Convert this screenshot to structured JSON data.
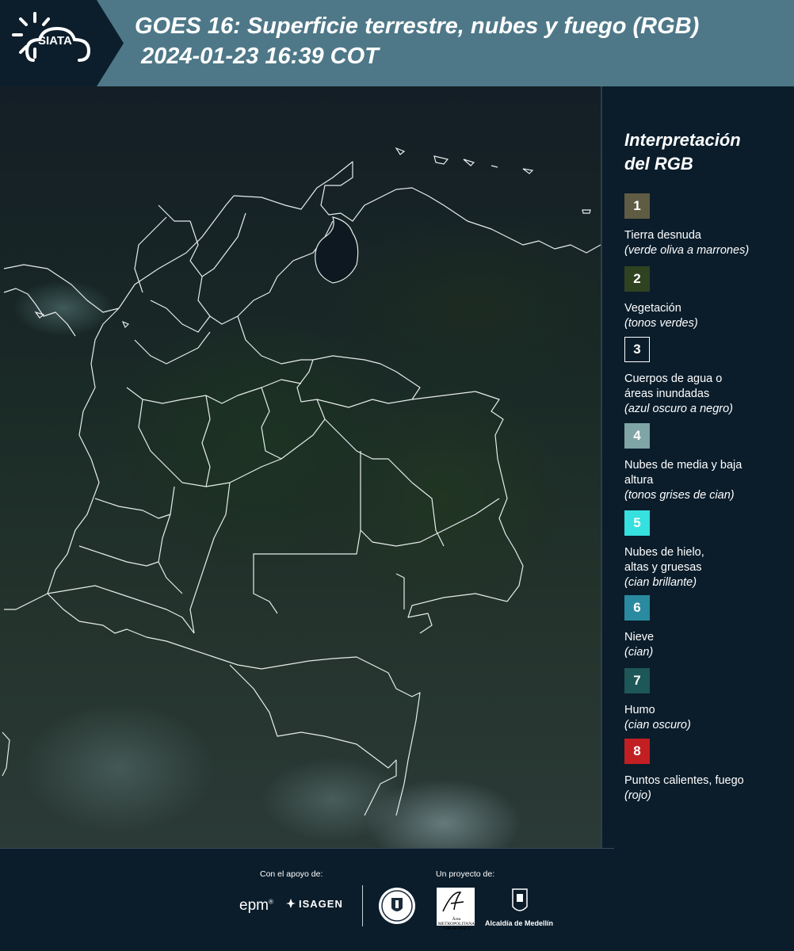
{
  "header": {
    "logo_text": "SIATA",
    "title_line1": "GOES 16: Superficie terrestre, nubes y fuego (RGB)",
    "title_line2": "2024-01-23 16:39 COT"
  },
  "legend": {
    "title_line1": "Interpretación",
    "title_line2": "del RGB",
    "items": [
      {
        "num": "1",
        "color": "#5f5c43",
        "label": "Tierra desnuda",
        "desc": "(verde oliva a marrones)"
      },
      {
        "num": "2",
        "color": "#2f4321",
        "label": "Vegetación",
        "desc": "(tonos verdes)"
      },
      {
        "num": "3",
        "color": "#0b1d2b",
        "label": "Cuerpos de agua o áreas inundadas",
        "desc": "(azul oscuro a negro)"
      },
      {
        "num": "4",
        "color": "#7fa5a6",
        "label": "Nubes de media y baja altura",
        "desc": "(tonos grises de cian)"
      },
      {
        "num": "5",
        "color": "#35e0df",
        "label": "Nubes de hielo, altas y gruesas",
        "desc": "(cian brillante)"
      },
      {
        "num": "6",
        "color": "#2a8aa0",
        "label": "Nieve",
        "desc": "(cian)"
      },
      {
        "num": "7",
        "color": "#1d5757",
        "label": "Humo",
        "desc": "(cian oscuro)"
      },
      {
        "num": "8",
        "color": "#c21f22",
        "label": "Puntos calientes, fuego",
        "desc": "(rojo)"
      }
    ]
  },
  "footer": {
    "support_label": "Con el apoyo de:",
    "project_label": "Un proyecto de:",
    "epm": "epm",
    "isagen": "ISAGEN",
    "area_logo": "Área METROPOLITANA Valle de Aburrá",
    "medellin": "Alcaldía de Medellín"
  }
}
